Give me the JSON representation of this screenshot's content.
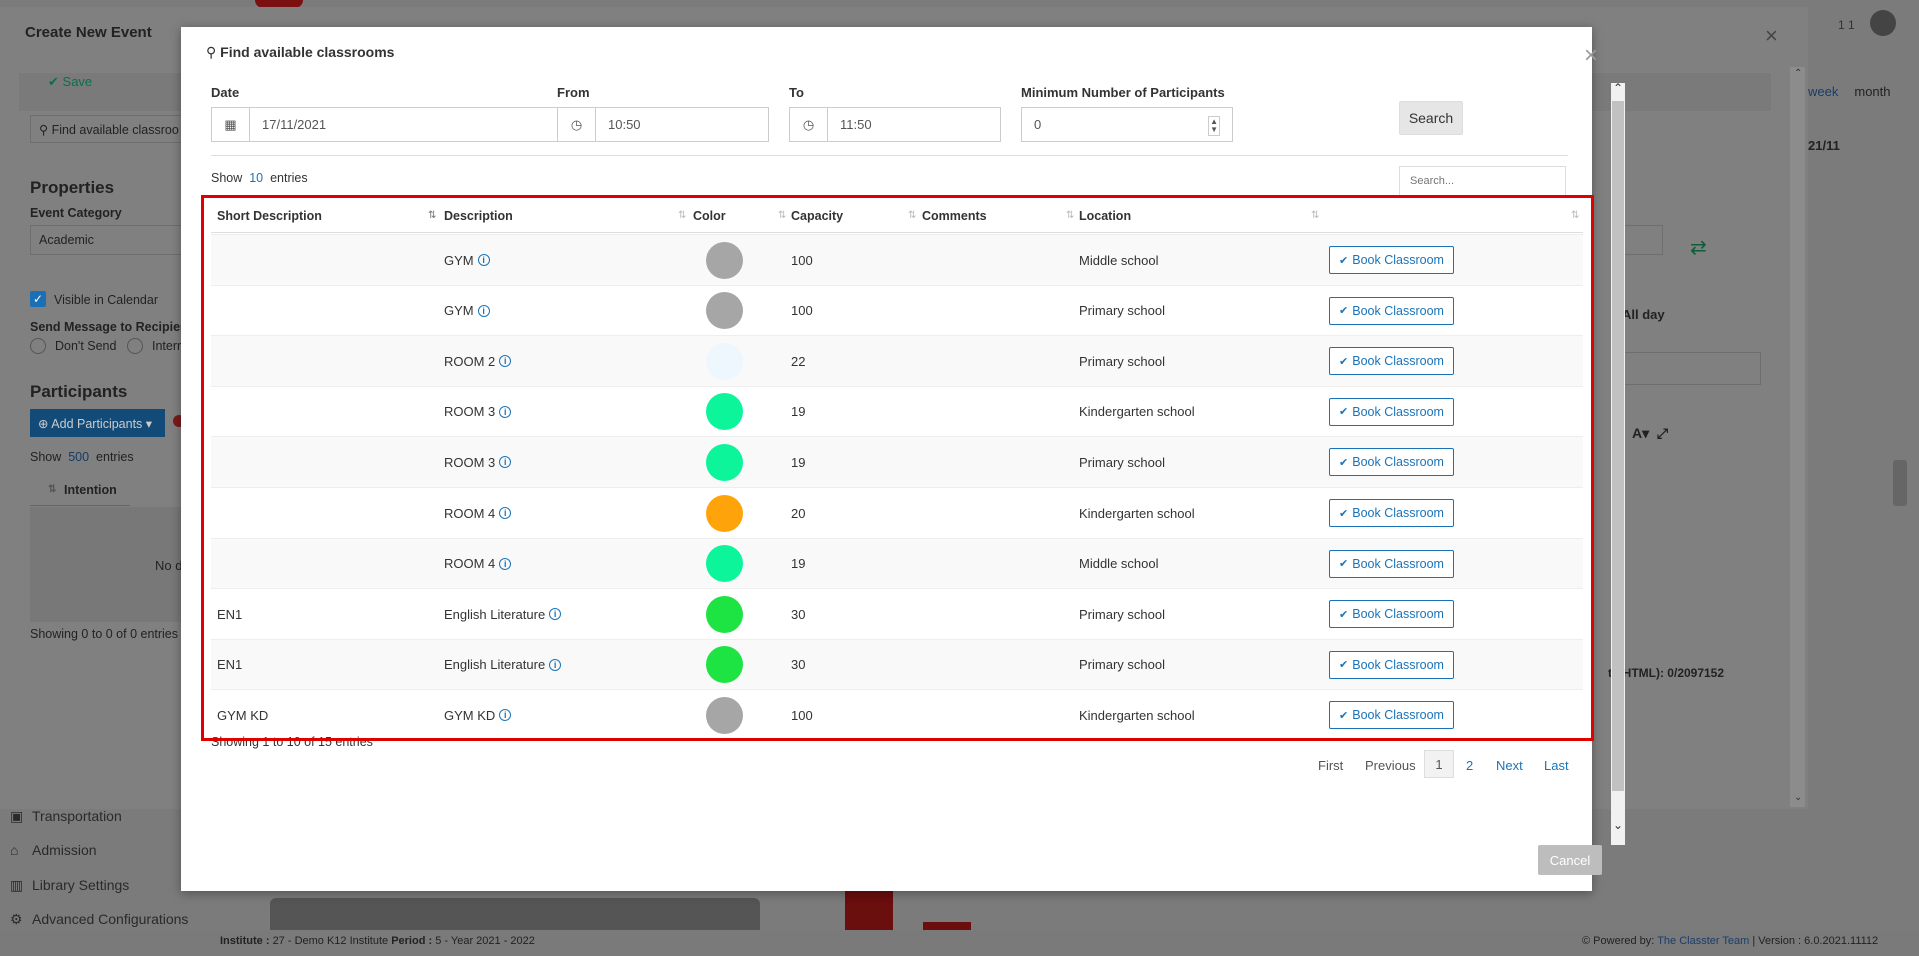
{
  "background": {
    "sidebar_links": [
      "Transportation",
      "Admission",
      "Library Settings",
      "Advanced Configurations"
    ],
    "footer": {
      "institute_label": "Institute :",
      "institute_value": "27 - Demo K12 Institute",
      "period_label": "Period :",
      "period_value": "5 - Year 2021 - 2022",
      "powered_by": "Powered by:",
      "team": "The Classter Team",
      "version": "Version : 6.0.2021.11112"
    },
    "calendar_views": [
      "week",
      "month"
    ],
    "date_range_fragment": "21/11",
    "all_day_label": "All day",
    "html_counter": "th HTML): 0/2097152",
    "user_count": "1 1"
  },
  "event_modal": {
    "title": "Create New Event",
    "save_label": "Save",
    "find_classrooms_label": "Find available classroo",
    "properties_heading": "Properties",
    "event_category_label": "Event Category",
    "event_category_value": "Academic",
    "visible_in_calendar_label": "Visible in Calendar",
    "visible_in_calendar_checked": true,
    "send_message_label": "Send Message to Recipients",
    "send_options": [
      "Don't Send",
      "Intern"
    ],
    "participants_heading": "Participants",
    "add_participants_label": "Add Participants",
    "show_label": "Show",
    "show_count": "500",
    "entries_label": "entries",
    "intention_header": "Intention",
    "no_data_fragment": "No d",
    "showing_text": "Showing 0 to 0 of 0 entries"
  },
  "classroom_modal": {
    "title": "Find available classrooms",
    "date_label": "Date",
    "date_value": "17/11/2021",
    "from_label": "From",
    "from_value": "10:50",
    "to_label": "To",
    "to_value": "11:50",
    "min_participants_label": "Minimum Number of Participants",
    "min_participants_value": "0",
    "search_button": "Search",
    "show_label": "Show",
    "show_count": "10",
    "entries_label": "entries",
    "search_placeholder": "Search...",
    "columns": [
      "Short Description",
      "Description",
      "Color",
      "Capacity",
      "Comments",
      "Location"
    ],
    "book_label": "Book Classroom",
    "rows": [
      {
        "short": "",
        "desc": "GYM",
        "color": "#a6a6a6",
        "capacity": "100",
        "comments": "",
        "location": "Middle school"
      },
      {
        "short": "",
        "desc": "GYM",
        "color": "#a6a6a6",
        "capacity": "100",
        "comments": "",
        "location": "Primary school"
      },
      {
        "short": "",
        "desc": "ROOM 2",
        "color": "#eef6fe",
        "capacity": "22",
        "comments": "",
        "location": "Primary school"
      },
      {
        "short": "",
        "desc": "ROOM 3",
        "color": "#0cf59a",
        "capacity": "19",
        "comments": "",
        "location": "Kindergarten school"
      },
      {
        "short": "",
        "desc": "ROOM 3",
        "color": "#0cf59a",
        "capacity": "19",
        "comments": "",
        "location": "Primary school"
      },
      {
        "short": "",
        "desc": "ROOM 4",
        "color": "#ffa30b",
        "capacity": "20",
        "comments": "",
        "location": "Kindergarten school"
      },
      {
        "short": "",
        "desc": "ROOM 4",
        "color": "#0cf59a",
        "capacity": "19",
        "comments": "",
        "location": "Middle school"
      },
      {
        "short": "EN1",
        "desc": "English Literature",
        "color": "#1de442",
        "capacity": "30",
        "comments": "",
        "location": "Primary school"
      },
      {
        "short": "EN1",
        "desc": "English Literature",
        "color": "#1de442",
        "capacity": "30",
        "comments": "",
        "location": "Primary school"
      },
      {
        "short": "GYM KD",
        "desc": "GYM KD",
        "color": "#a6a6a6",
        "capacity": "100",
        "comments": "",
        "location": "Kindergarten school"
      }
    ],
    "showing_text": "Showing 1 to 10 of 15 entries",
    "pagination": {
      "first": "First",
      "previous": "Previous",
      "pages": [
        "1",
        "2"
      ],
      "next": "Next",
      "last": "Last",
      "current": "1"
    },
    "cancel_label": "Cancel",
    "highlight_color": "#e00000"
  }
}
